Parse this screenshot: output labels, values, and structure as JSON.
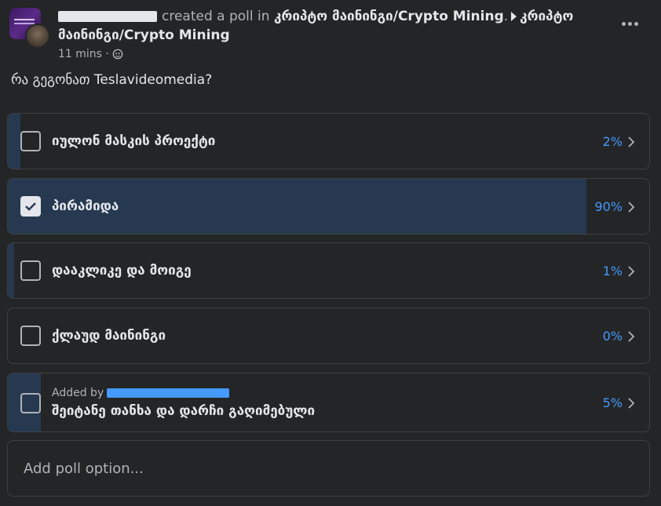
{
  "header": {
    "created_text": "created a poll in",
    "group_name": "კრიპტო მაინინგი/Crypto Mining",
    "group_name_repeat": "კრიპტო მაინინგი/Crypto Mining",
    "timestamp": "11 mins"
  },
  "question": "რა გეგონათ Teslavideomedia?",
  "poll": {
    "options": [
      {
        "label": "იულონ მასკის პროექტი",
        "percent": "2%",
        "value": 2,
        "checked": false
      },
      {
        "label": "პირამიდა",
        "percent": "90%",
        "value": 90,
        "checked": true
      },
      {
        "label": "დააკლიკე და მოიგე",
        "percent": "1%",
        "value": 1,
        "checked": false
      },
      {
        "label": "ქლაუდ მაინინგი",
        "percent": "0%",
        "value": 0,
        "checked": false
      },
      {
        "label": "შეიტანე თანხა და დარჩი გაღიმებული",
        "percent": "5%",
        "value": 5,
        "checked": false,
        "added_by_label": "Added by"
      }
    ],
    "add_placeholder": "Add poll option...",
    "fill_color": "#263951",
    "percent_color": "#4599ff"
  },
  "icons": [
    "more-icon",
    "globe-icon",
    "check-icon",
    "chevron-right-icon",
    "arrow-right-icon"
  ]
}
